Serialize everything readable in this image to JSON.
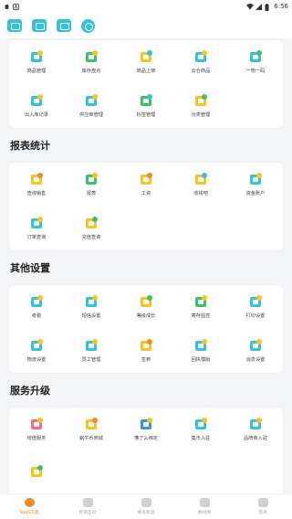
{
  "status_bar": {
    "left_icons": [
      "bug-icon",
      "a-letter-icon"
    ],
    "time": "6:56"
  },
  "colors": {
    "accent": "#f08a2b",
    "teal": "#35c3d8",
    "green": "#3cc36a",
    "yellow": "#f7c325",
    "orange": "#f08a2b",
    "blue": "#3a8fe8",
    "pink": "#f46b8c"
  },
  "top_card": [
    {
      "label": "商品管理",
      "icon": "box-icon",
      "color": "#35c3d8",
      "accent": "#f7c325"
    },
    {
      "label": "库存盘点",
      "icon": "inventory-icon",
      "color": "#3cc36a",
      "accent": "#f7c325"
    },
    {
      "label": "商品上架",
      "icon": "cart-icon",
      "color": "#f7c325",
      "accent": "#35c3d8"
    },
    {
      "label": "云仓商品",
      "icon": "warehouse-icon",
      "color": "#35c3d8",
      "accent": "#f7c325"
    },
    {
      "label": "一物一码",
      "icon": "qrcode-icon",
      "color": "#35c3d8",
      "accent": "#3cc36a"
    },
    {
      "label": "出入库记录",
      "icon": "stock-record-icon",
      "color": "#35c3d8",
      "accent": "#f7c325"
    },
    {
      "label": "供应商管理",
      "icon": "supplier-icon",
      "color": "#35c3d8",
      "accent": "#f7c325"
    },
    {
      "label": "标签管理",
      "icon": "tag-icon",
      "color": "#3cc36a",
      "accent": "#35c3d8"
    },
    {
      "label": "分类管理",
      "icon": "category-icon",
      "color": "#f7c325",
      "accent": "#3cc36a"
    }
  ],
  "sections": [
    {
      "title": "报表统计",
      "items": [
        {
          "label": "查询销售",
          "icon": "sales-query-icon",
          "color": "#f7c325",
          "accent": "#f08a2b"
        },
        {
          "label": "报表",
          "icon": "pie-chart-icon",
          "color": "#3cc36a",
          "accent": "#f7c325"
        },
        {
          "label": "工资",
          "icon": "salary-icon",
          "color": "#f7c325",
          "accent": "#f08a2b"
        },
        {
          "label": "收钱吧",
          "icon": "wallet-icon",
          "color": "#f7c325",
          "accent": "#35c3d8"
        },
        {
          "label": "资金账户",
          "icon": "bank-account-icon",
          "color": "#35c3d8",
          "accent": "#f7c325"
        },
        {
          "label": "订单查询",
          "icon": "order-query-icon",
          "color": "#35c3d8",
          "accent": "#f7c325"
        },
        {
          "label": "充值查询",
          "icon": "recharge-query-icon",
          "color": "#f7c325",
          "accent": "#3cc36a"
        }
      ]
    },
    {
      "title": "其他设置",
      "items": [
        {
          "label": "考勤",
          "icon": "attendance-icon",
          "color": "#35c3d8",
          "accent": "#f7c325"
        },
        {
          "label": "短信设置",
          "icon": "sms-icon",
          "color": "#35c3d8",
          "accent": "#f7c325"
        },
        {
          "label": "等级成长",
          "icon": "level-up-icon",
          "color": "#f7c325",
          "accent": "#3cc36a"
        },
        {
          "label": "寄存监控",
          "icon": "storage-monitor-icon",
          "color": "#3cc36a",
          "accent": "#f7c325"
        },
        {
          "label": "打印设置",
          "icon": "printer-icon",
          "color": "#35c3d8",
          "accent": "#f7c325"
        },
        {
          "label": "物流设置",
          "icon": "truck-icon",
          "color": "#35c3d8",
          "accent": "#f7c325"
        },
        {
          "label": "员工管理",
          "icon": "staff-icon",
          "color": "#35c3d8",
          "accent": "#f7c325"
        },
        {
          "label": "签到",
          "icon": "check-in-icon",
          "color": "#f7c325",
          "accent": "#f08a2b"
        },
        {
          "label": "回执模版",
          "icon": "receipt-template-icon",
          "color": "#35c3d8",
          "accent": "#f7c325"
        },
        {
          "label": "消息设置",
          "icon": "message-settings-icon",
          "color": "#35c3d8",
          "accent": "#f7c325"
        }
      ]
    },
    {
      "title": "服务升级",
      "items": [
        {
          "label": "增值服务",
          "icon": "value-added-icon",
          "color": "#f46b8c",
          "accent": "#f7c325"
        },
        {
          "label": "蜗牛币商城",
          "icon": "coin-mall-icon",
          "color": "#f7c325",
          "accent": "#f08a2b"
        },
        {
          "label": "懂了么绑定",
          "icon": "binding-icon",
          "color": "#3a8fe8",
          "accent": "#f7c325"
        },
        {
          "label": "集市入驻",
          "icon": "market-join-icon",
          "color": "#35c3d8",
          "accent": "#f7c325"
        },
        {
          "label": "品牌商入驻",
          "icon": "brand-join-icon",
          "color": "#35c3d8",
          "accent": "#f7c325"
        },
        {
          "label": "",
          "icon": "service-extra-icon",
          "color": "#f7c325",
          "accent": "#3cc36a"
        }
      ]
    }
  ],
  "bottom_nav": [
    {
      "label": "SaaS工具",
      "icon": "saas-tools-icon",
      "active": true
    },
    {
      "label": "营销互动",
      "icon": "marketing-icon",
      "active": false
    },
    {
      "label": "蜂鸟新品",
      "icon": "new-products-icon",
      "active": false
    },
    {
      "label": "素材库",
      "icon": "materials-icon",
      "active": false
    },
    {
      "label": "我点",
      "icon": "my-icon",
      "active": false
    }
  ]
}
